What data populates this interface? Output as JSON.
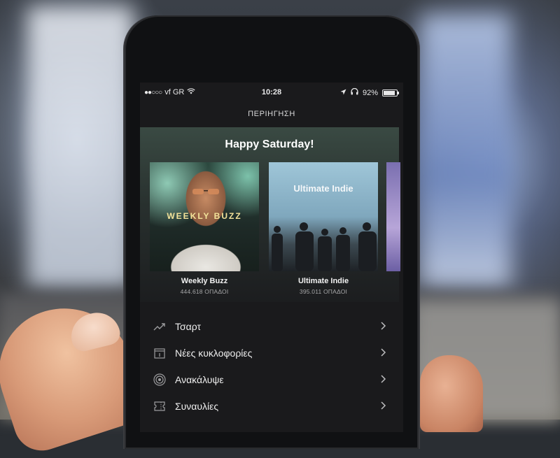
{
  "status_bar": {
    "signal": "●●○○○",
    "carrier": "vf GR",
    "time": "10:28",
    "battery": "92%"
  },
  "header": {
    "title": "ΠΕΡΙΗΓΗΣΗ"
  },
  "featured": {
    "heading": "Happy Saturday!",
    "playlists": [
      {
        "art_text": "WEEKLY BUZZ",
        "name": "Weekly Buzz",
        "followers": "444.618 ΟΠΑΔΟΙ"
      },
      {
        "art_text": "Ultimate Indie",
        "name": "Ultimate Indie",
        "followers": "395.011 ΟΠΑΔΟΙ"
      }
    ]
  },
  "menu": [
    {
      "label": "Τσαρτ",
      "icon": "trending-icon"
    },
    {
      "label": "Νέες κυκλοφορίες",
      "icon": "calendar-icon"
    },
    {
      "label": "Ανακάλυψε",
      "icon": "discover-icon"
    },
    {
      "label": "Συναυλίες",
      "icon": "ticket-icon"
    }
  ],
  "colors": {
    "screen_bg": "#1a1a1c",
    "accent_text": "#f3e39a"
  }
}
